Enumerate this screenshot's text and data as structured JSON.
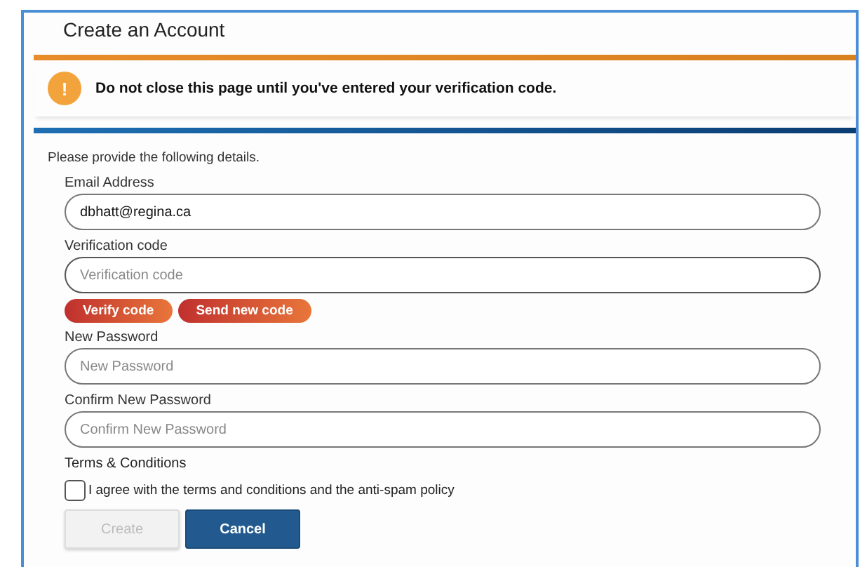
{
  "title": "Create an Account",
  "alert": {
    "icon": "!",
    "message": "Do not close this page until you've entered your verification code."
  },
  "intro": "Please provide the following details.",
  "fields": [
    {
      "kind": "input",
      "label": "Email Address",
      "value": "dbhatt@regina.ca"
    },
    {
      "kind": "input",
      "label": "Verification code",
      "placeholder": "Verification code",
      "focused": true
    },
    {
      "kind": "actions",
      "buttons": [
        "Verify code",
        "Send new code"
      ]
    },
    {
      "kind": "input",
      "label": "New Password",
      "placeholder": "New Password"
    },
    {
      "kind": "input",
      "label": "Confirm New Password",
      "placeholder": "Confirm New Password"
    }
  ],
  "terms": {
    "heading": "Terms & Conditions",
    "label": "I agree with the terms and conditions and the anti-spam policy",
    "checked": false
  },
  "buttons": [
    {
      "label": "Create",
      "disabled": true
    },
    {
      "label": "Cancel",
      "disabled": false
    }
  ]
}
